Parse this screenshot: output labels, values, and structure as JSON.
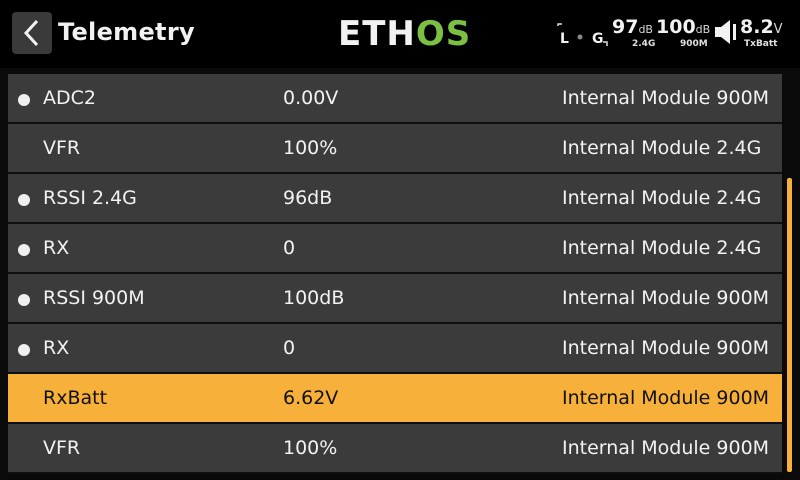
{
  "header": {
    "title": "Telemetry",
    "logo_main": "ETH",
    "logo_accent": "OS",
    "logo_accent_color": "#7bc043",
    "trim_left_label": "L",
    "trim_right_label": "G",
    "rssi_24": {
      "value": "97",
      "unit": "dB",
      "label": "2.4G"
    },
    "rssi_900": {
      "value": "100",
      "unit": "dB",
      "label": "900M"
    },
    "battery": {
      "value": "8.2",
      "unit": "V",
      "label": "TxBatt"
    },
    "volume_icon": "speaker-icon"
  },
  "rows": [
    {
      "name": "ADC2",
      "value": "0.00V",
      "source": "Internal Module 900M",
      "dot": true,
      "selected": false
    },
    {
      "name": "VFR",
      "value": "100%",
      "source": "Internal Module 2.4G",
      "dot": false,
      "selected": false
    },
    {
      "name": "RSSI 2.4G",
      "value": "96dB",
      "source": "Internal Module 2.4G",
      "dot": true,
      "selected": false
    },
    {
      "name": "RX",
      "value": "0",
      "source": "Internal Module 2.4G",
      "dot": true,
      "selected": false
    },
    {
      "name": "RSSI 900M",
      "value": "100dB",
      "source": "Internal Module 900M",
      "dot": true,
      "selected": false
    },
    {
      "name": "RX",
      "value": "0",
      "source": "Internal Module 900M",
      "dot": true,
      "selected": false
    },
    {
      "name": "RxBatt",
      "value": "6.62V",
      "source": "Internal Module 900M",
      "dot": false,
      "selected": true
    },
    {
      "name": "VFR",
      "value": "100%",
      "source": "Internal Module 900M",
      "dot": false,
      "selected": false
    }
  ],
  "colors": {
    "accent": "#f7b03a",
    "row_bg": "#3b3b3b",
    "header_bg": "#000000"
  }
}
